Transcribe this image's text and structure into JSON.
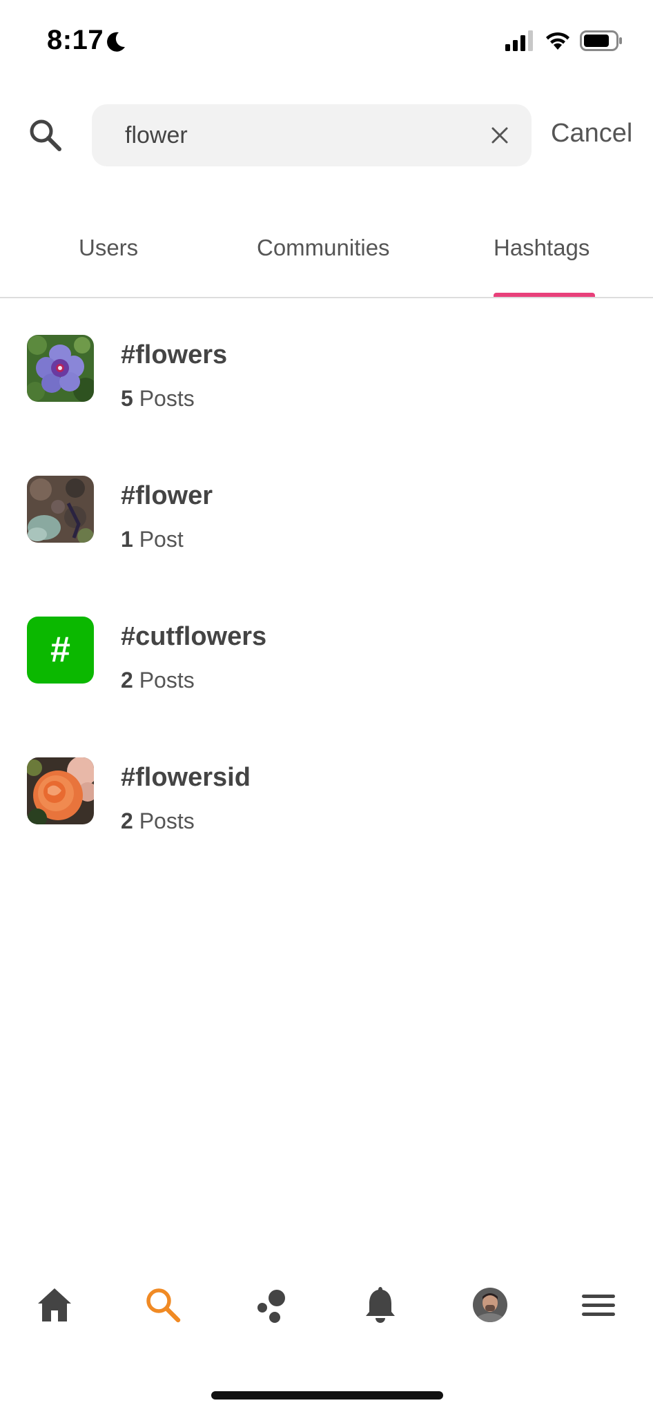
{
  "status_bar": {
    "time": "8:17"
  },
  "search": {
    "value": "flower",
    "placeholder": "",
    "cancel_label": "Cancel"
  },
  "tabs": [
    {
      "label": "Users",
      "active": false
    },
    {
      "label": "Communities",
      "active": false
    },
    {
      "label": "Hashtags",
      "active": true
    }
  ],
  "accent_color": "#e8407a",
  "hashtags": [
    {
      "tag": "#flowers",
      "count": "5",
      "unit": "Posts",
      "thumbnail": "purple-flower-photo"
    },
    {
      "tag": "#flower",
      "count": "1",
      "unit": "Post",
      "thumbnail": "garden-ground-photo"
    },
    {
      "tag": "#cutflowers",
      "count": "2",
      "unit": "Posts",
      "thumbnail": "hash-placeholder",
      "placeholder_glyph": "#",
      "placeholder_color": "#0bb800"
    },
    {
      "tag": "#flowersid",
      "count": "2",
      "unit": "Posts",
      "thumbnail": "orange-rose-photo"
    }
  ],
  "bottom_nav": [
    {
      "name": "home-icon",
      "active": false
    },
    {
      "name": "search-icon",
      "active": true,
      "color": "#f08a24"
    },
    {
      "name": "communities-icon",
      "active": false
    },
    {
      "name": "bell-icon",
      "active": false
    },
    {
      "name": "avatar",
      "active": false
    },
    {
      "name": "menu-icon",
      "active": false
    }
  ]
}
